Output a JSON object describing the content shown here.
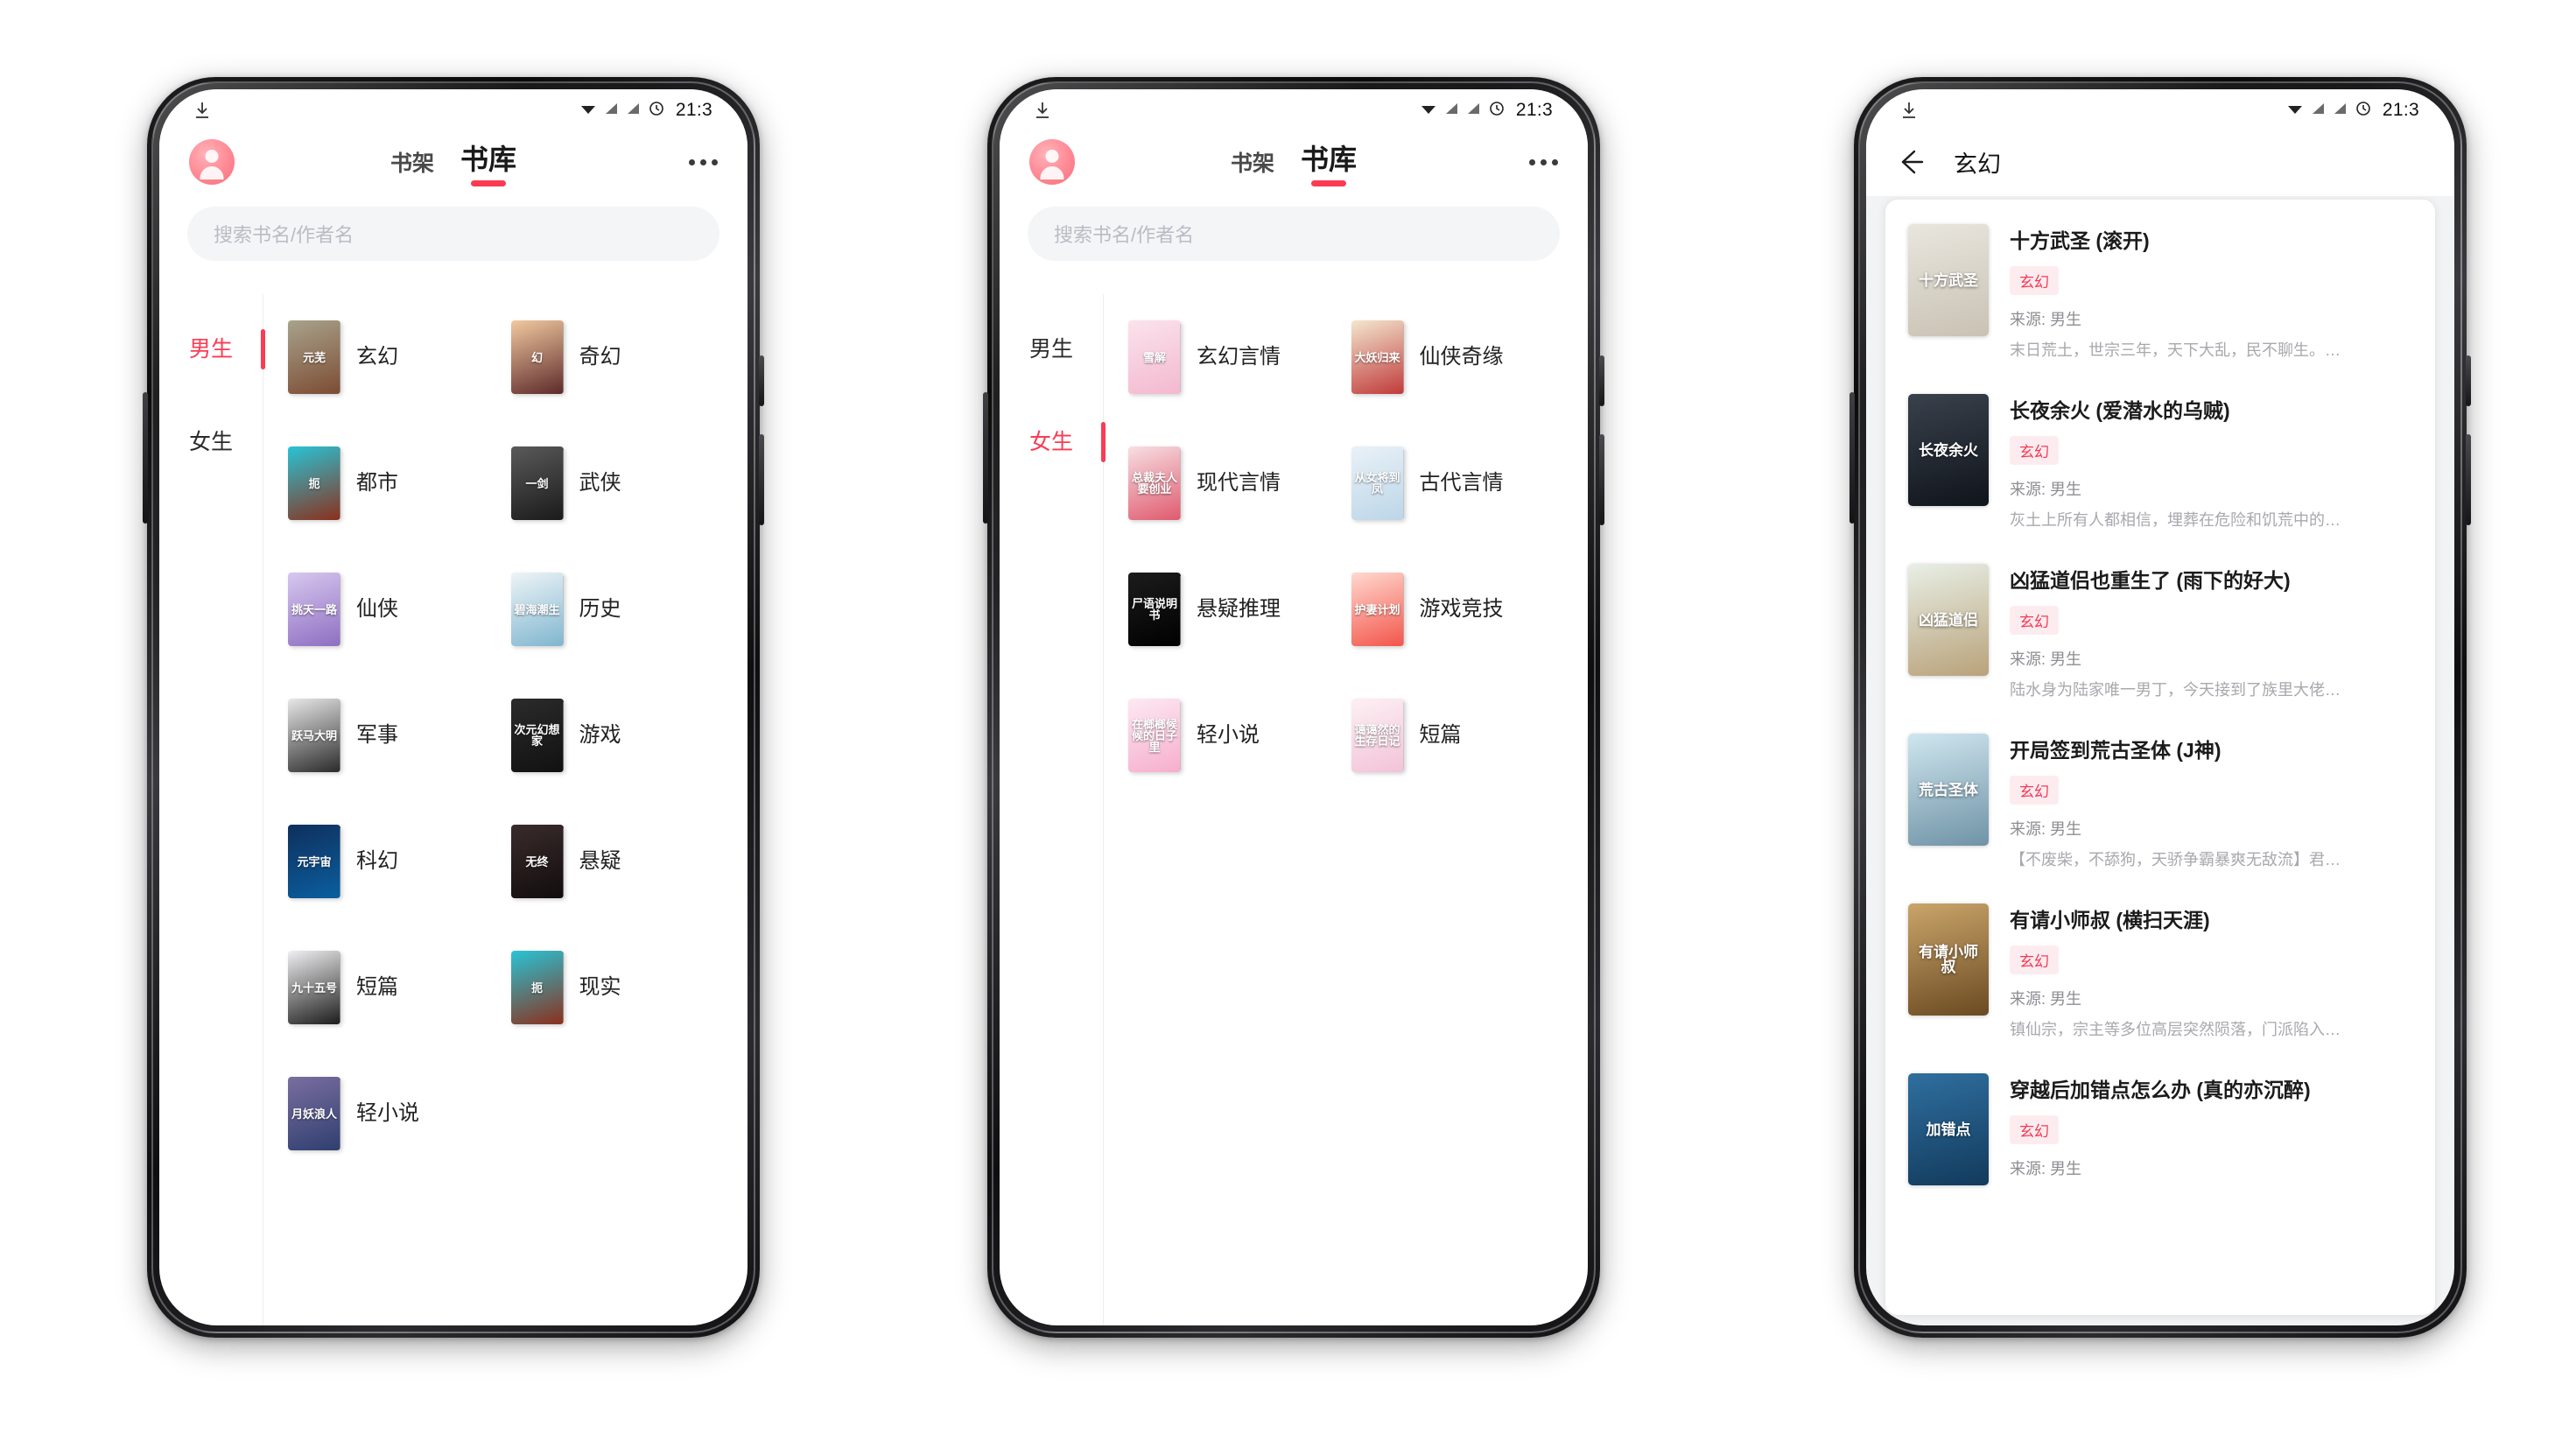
{
  "status_bar": {
    "time": "21:3",
    "icons": [
      "wifi-icon",
      "signal-icon",
      "signal2-icon",
      "alarm-icon"
    ],
    "download_icon": "download-icon"
  },
  "accent": {
    "primary": "#fb3b53",
    "tag_bg": "#fdecef",
    "tag_text": "#f23b57",
    "avatar": "#ff8e99"
  },
  "header": {
    "avatar": "user-avatar",
    "tabs": [
      {
        "label": "书架",
        "active": false
      },
      {
        "label": "书库",
        "active": true
      }
    ],
    "more_label": "more-menu"
  },
  "search": {
    "placeholder": "搜索书名/作者名"
  },
  "phone1": {
    "sidebar": [
      {
        "label": "男生",
        "active": true
      },
      {
        "label": "女生",
        "active": false
      }
    ],
    "categories": [
      {
        "label": "玄幻",
        "cover_title": "元芜",
        "c1": "#a8a38c",
        "c2": "#7d4b33"
      },
      {
        "label": "奇幻",
        "cover_title": "幻",
        "c1": "#f2c9a0",
        "c2": "#5c2a2a"
      },
      {
        "label": "都市",
        "cover_title": "扼",
        "c1": "#28c4d6",
        "c2": "#8c2f1c"
      },
      {
        "label": "武侠",
        "cover_title": "一剑",
        "c1": "#5a5a5a",
        "c2": "#1a1a1a"
      },
      {
        "label": "仙侠",
        "cover_title": "挑天一路",
        "c1": "#d7c7ef",
        "c2": "#8e6fc2"
      },
      {
        "label": "历史",
        "cover_title": "碧海潮生",
        "c1": "#eef4f7",
        "c2": "#7fb6cf"
      },
      {
        "label": "军事",
        "cover_title": "跃马大明",
        "c1": "#e8e8e8",
        "c2": "#2a2a2a"
      },
      {
        "label": "游戏",
        "cover_title": "次元幻想家",
        "c1": "#2b2b2b",
        "c2": "#111"
      },
      {
        "label": "科幻",
        "cover_title": "元宇宙",
        "c1": "#0f2f5c",
        "c2": "#0a5fa0"
      },
      {
        "label": "悬疑",
        "cover_title": "无终",
        "c1": "#3a2b2b",
        "c2": "#120d0d"
      },
      {
        "label": "短篇",
        "cover_title": "九十五号",
        "c1": "#f0f0f2",
        "c2": "#1c1c1c"
      },
      {
        "label": "现实",
        "cover_title": "扼",
        "c1": "#28c4d6",
        "c2": "#8c2f1c"
      },
      {
        "label": "轻小说",
        "cover_title": "月妖浪人",
        "c1": "#7a6ea0",
        "c2": "#2f3f6f"
      }
    ]
  },
  "phone2": {
    "sidebar": [
      {
        "label": "男生",
        "active": false
      },
      {
        "label": "女生",
        "active": true
      }
    ],
    "categories": [
      {
        "label": "玄幻言情",
        "cover_title": "雪解",
        "c1": "#fbe3ec",
        "c2": "#f3b8cf"
      },
      {
        "label": "仙侠奇缘",
        "cover_title": "大妖归来",
        "c1": "#f3e7cf",
        "c2": "#c03a3a"
      },
      {
        "label": "现代言情",
        "cover_title": "总裁夫人要创业",
        "c1": "#f7dfe3",
        "c2": "#e05a6e"
      },
      {
        "label": "古代言情",
        "cover_title": "从女将到凤",
        "c1": "#eaf1f7",
        "c2": "#bcd6e8"
      },
      {
        "label": "悬疑推理",
        "cover_title": "尸语说明书",
        "c1": "#1c1c1c",
        "c2": "#000"
      },
      {
        "label": "游戏竞技",
        "cover_title": "护妻计划",
        "c1": "#ffd9d0",
        "c2": "#f3554a"
      },
      {
        "label": "轻小说",
        "cover_title": "在榔榔候候的日子里",
        "c1": "#fde9f2",
        "c2": "#f6aecd"
      },
      {
        "label": "短篇",
        "cover_title": "蔼蔼然的生存日记",
        "c1": "#fdf0f4",
        "c2": "#f2c3d8"
      }
    ]
  },
  "phone3": {
    "title": "玄幻",
    "back_icon": "back-arrow-icon",
    "books": [
      {
        "title": "十方武圣 (滚开)",
        "tag": "玄幻",
        "source": "来源: 男生",
        "desc": "末日荒土，世宗三年，天下大乱，民不聊生。…",
        "cover_title": "十方武圣",
        "c1": "#e9e6de",
        "c2": "#c9c2b4"
      },
      {
        "title": "长夜余火 (爱潜水的乌贼)",
        "tag": "玄幻",
        "source": "来源: 男生",
        "desc": "灰土上所有人都相信，埋葬在危险和饥荒中的…",
        "cover_title": "长夜余火",
        "c1": "#39414c",
        "c2": "#10141b"
      },
      {
        "title": "凶猛道侣也重生了 (雨下的好大)",
        "tag": "玄幻",
        "source": "来源: 男生",
        "desc": "陆水身为陆家唯一男丁，今天接到了族里大佬…",
        "cover_title": "凶猛道侣",
        "c1": "#e8efe6",
        "c2": "#b9a27a"
      },
      {
        "title": "开局签到荒古圣体 (J神)",
        "tag": "玄幻",
        "source": "来源: 男生",
        "desc": "【不废柴，不舔狗，天骄争霸暴爽无敌流】君…",
        "cover_title": "荒古圣体",
        "c1": "#cfe6ef",
        "c2": "#6f93a6"
      },
      {
        "title": "有请小师叔 (横扫天涯)",
        "tag": "玄幻",
        "source": "来源: 男生",
        "desc": "镇仙宗，宗主等多位高层突然陨落，门派陷入…",
        "cover_title": "有请小师叔",
        "c1": "#caa56a",
        "c2": "#6b4a22"
      },
      {
        "title": "穿越后加错点怎么办 (真的亦沉醉)",
        "tag": "玄幻",
        "source": "来源: 男生",
        "desc": "",
        "cover_title": "加错点",
        "c1": "#2f6f9f",
        "c2": "#123a5c"
      }
    ]
  }
}
